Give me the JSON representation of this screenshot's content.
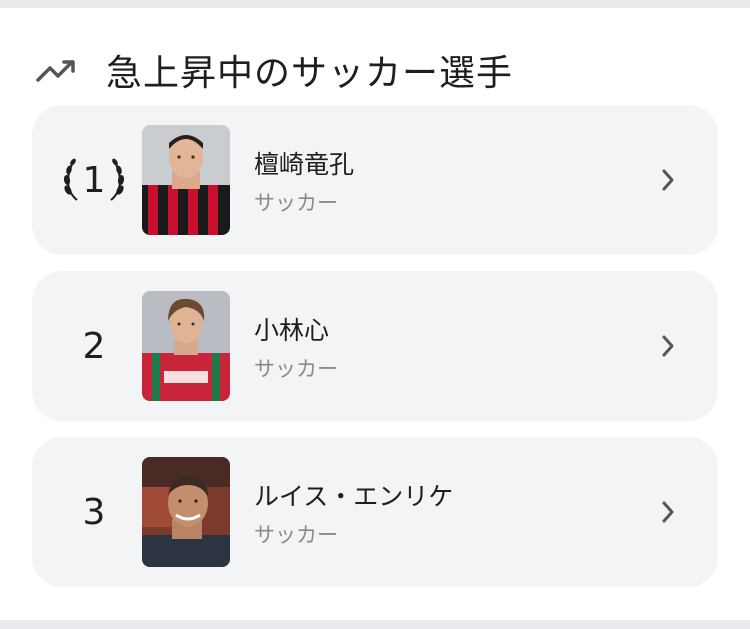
{
  "section": {
    "icon": "trending-up-icon",
    "title": "急上昇中のサッカー選手"
  },
  "ranking": [
    {
      "rank": "1",
      "badge": "laurel-icon",
      "name": "檀崎竜孔",
      "category": "サッカー",
      "avatar": "player-photo-red-black-kit"
    },
    {
      "rank": "2",
      "name": "小林心",
      "category": "サッカー",
      "avatar": "player-photo-red-green-kit"
    },
    {
      "rank": "3",
      "name": "ルイス・エンリケ",
      "category": "サッカー",
      "avatar": "person-photo-selfie"
    }
  ],
  "colors": {
    "card_bg": "#ffffff",
    "item_bg": "#f3f4f6",
    "text_primary": "#1e1e1e",
    "text_secondary": "#8a8a8a",
    "page_bg": "#ebebef"
  }
}
